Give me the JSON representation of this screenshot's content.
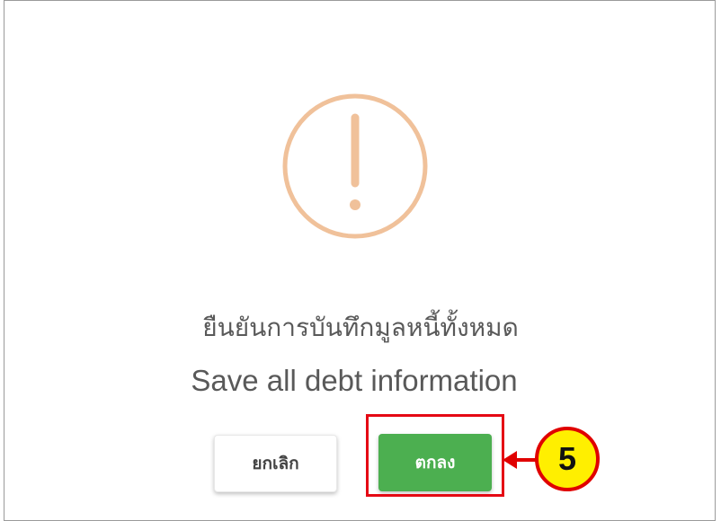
{
  "dialog": {
    "icon": "warning-exclamation-icon",
    "title_thai": "ยืนยันการบันทึกมูลหนี้ทั้งหมด",
    "title_english": "Save all debt information",
    "cancel_label": "ยกเลิก",
    "ok_label": "ตกลง"
  },
  "annotation": {
    "step_number": "5"
  },
  "colors": {
    "icon": "#f0c19a",
    "ok_button": "#4caf50",
    "highlight": "#e50914",
    "badge_fill": "#ffef00"
  }
}
